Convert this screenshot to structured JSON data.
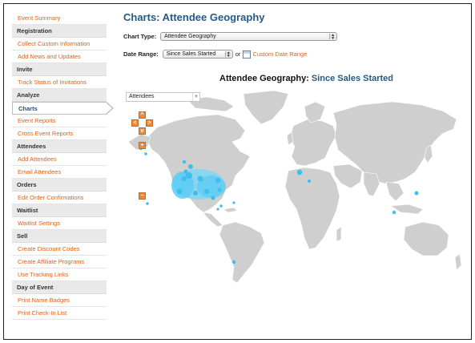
{
  "sidebar": {
    "items": [
      {
        "kind": "link",
        "label": "Event Summary"
      },
      {
        "kind": "head",
        "label": "Registration"
      },
      {
        "kind": "link",
        "label": "Collect Custom Information"
      },
      {
        "kind": "link",
        "label": "Add News and Updates"
      },
      {
        "kind": "head",
        "label": "Invite"
      },
      {
        "kind": "link",
        "label": "Track Status of Invitations"
      },
      {
        "kind": "head",
        "label": "Analyze"
      },
      {
        "kind": "active",
        "label": "Charts"
      },
      {
        "kind": "link",
        "label": "Event Reports"
      },
      {
        "kind": "link",
        "label": "Cross Event Reports"
      },
      {
        "kind": "head",
        "label": "Attendees"
      },
      {
        "kind": "link",
        "label": "Add Attendees"
      },
      {
        "kind": "link",
        "label": "Email Attendees"
      },
      {
        "kind": "head",
        "label": "Orders"
      },
      {
        "kind": "link",
        "label": "Edit Order Confirmations"
      },
      {
        "kind": "head",
        "label": "Waitlist"
      },
      {
        "kind": "link",
        "label": "Waitlist Settings"
      },
      {
        "kind": "head",
        "label": "Sell"
      },
      {
        "kind": "link",
        "label": "Create Discount Codes"
      },
      {
        "kind": "link",
        "label": "Create Affiliate Programs"
      },
      {
        "kind": "link",
        "label": "Use Tracking Links"
      },
      {
        "kind": "head",
        "label": "Day of Event"
      },
      {
        "kind": "link",
        "label": "Print Name Badges"
      },
      {
        "kind": "link",
        "label": "Print Check-In List"
      }
    ]
  },
  "main": {
    "title": "Charts: Attendee Geography",
    "chart_type_label": "Chart Type:",
    "chart_type_value": "Attendee Geography",
    "date_range_label": "Date Range:",
    "date_range_value": "Since Sales Started",
    "or_text": "or",
    "custom_range_link": "Custom Date Range"
  },
  "map": {
    "title_prefix": "Attendee Geography: ",
    "title_range": "Since Sales Started",
    "metric_value": "Attendees",
    "controls": {
      "up": "^",
      "left": "<",
      "right": ">",
      "down": "v",
      "zoom_in": "+",
      "zoom_out": "−"
    },
    "colors": {
      "land": "#cfcfcf",
      "bubble": "#4cc3f0",
      "bubble_light": "#7fd6f7",
      "accent": "#d9621b"
    }
  }
}
